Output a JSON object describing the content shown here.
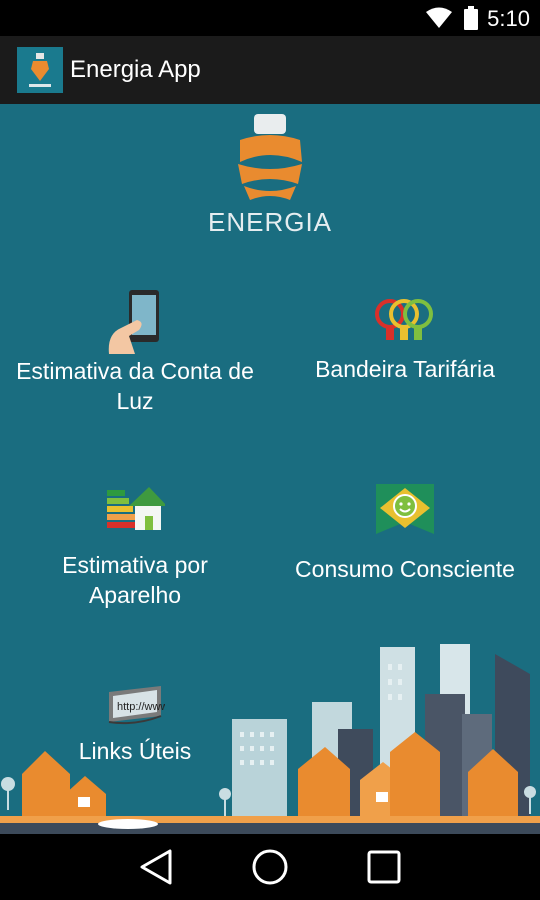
{
  "status_bar": {
    "time": "5:10"
  },
  "app_bar": {
    "title": "Energia App",
    "logo_icon": "lightbulb-logo"
  },
  "brand": {
    "text": "ENERGIA"
  },
  "menu": [
    {
      "label": "Estimativa da Conta de Luz",
      "icon": "phone-bill-icon"
    },
    {
      "label": "Bandeira Tarifária",
      "icon": "tariff-flag-bulbs-icon"
    },
    {
      "label": "Estimativa por Aparelho",
      "icon": "energy-rating-house-icon"
    },
    {
      "label": "Consumo Consciente",
      "icon": "smiley-flag-icon"
    },
    {
      "label": "Links Úteis",
      "icon": "http-links-icon"
    }
  ],
  "nav": {
    "back": "back-icon",
    "home": "home-icon",
    "recents": "recents-icon"
  },
  "colors": {
    "background": "#1a6d80",
    "accent": "#e98b2f",
    "app_bar": "#1b1b1b"
  }
}
